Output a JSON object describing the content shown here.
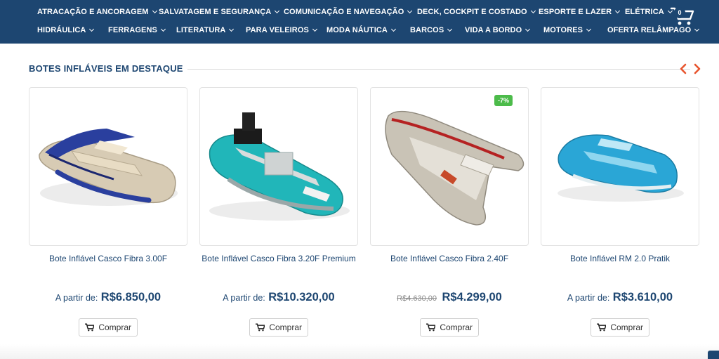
{
  "nav": {
    "row1": [
      "ATRACAÇÃO E ANCORAGEM",
      "SALVATAGEM E SEGURANÇA",
      "COMUNICAÇÃO E NAVEGAÇÃO",
      "DECK, COCKPIT E COSTADO",
      "ESPORTE E LAZER",
      "ELÉTRICA"
    ],
    "row2": [
      "HIDRÁULICA",
      "FERRAGENS",
      "LITERATURA",
      "PARA VELEIROS",
      "MODA NÁUTICA",
      "BARCOS",
      "VIDA A BORDO",
      "MOTORES",
      "OFERTA RELÂMPAGO"
    ]
  },
  "cart": {
    "icon": "shopping-cart-icon",
    "count": "0"
  },
  "section": {
    "title": "BOTES INFLÁVEIS EM DESTAQUE",
    "prev_icon": "chevron-left-icon",
    "next_icon": "chevron-right-icon",
    "arrow_color": "#e8552e"
  },
  "products": [
    {
      "name": "Bote Inflável Casco Fibra 3.00F",
      "price_prefix": "A partir de:",
      "old_price": "",
      "price": "R$6.850,00",
      "button": "Comprar",
      "badge": ""
    },
    {
      "name": "Bote Inflável Casco Fibra 3.20F Premium",
      "price_prefix": "A partir de:",
      "old_price": "",
      "price": "R$10.320,00",
      "button": "Comprar",
      "badge": ""
    },
    {
      "name": "Bote Inflável Casco Fibra 2.40F",
      "price_prefix": "",
      "old_price": "R$4.630,00",
      "price": "R$4.299,00",
      "button": "Comprar",
      "badge": "-7%"
    },
    {
      "name": "Bote Inflável RM 2.0 Pratik",
      "price_prefix": "A partir de:",
      "old_price": "",
      "price": "R$3.610,00",
      "button": "Comprar",
      "badge": ""
    }
  ],
  "colors": {
    "nav_bg": "#1d4671",
    "brand_text": "#1d4671",
    "badge_bg": "#4cbb4a"
  }
}
